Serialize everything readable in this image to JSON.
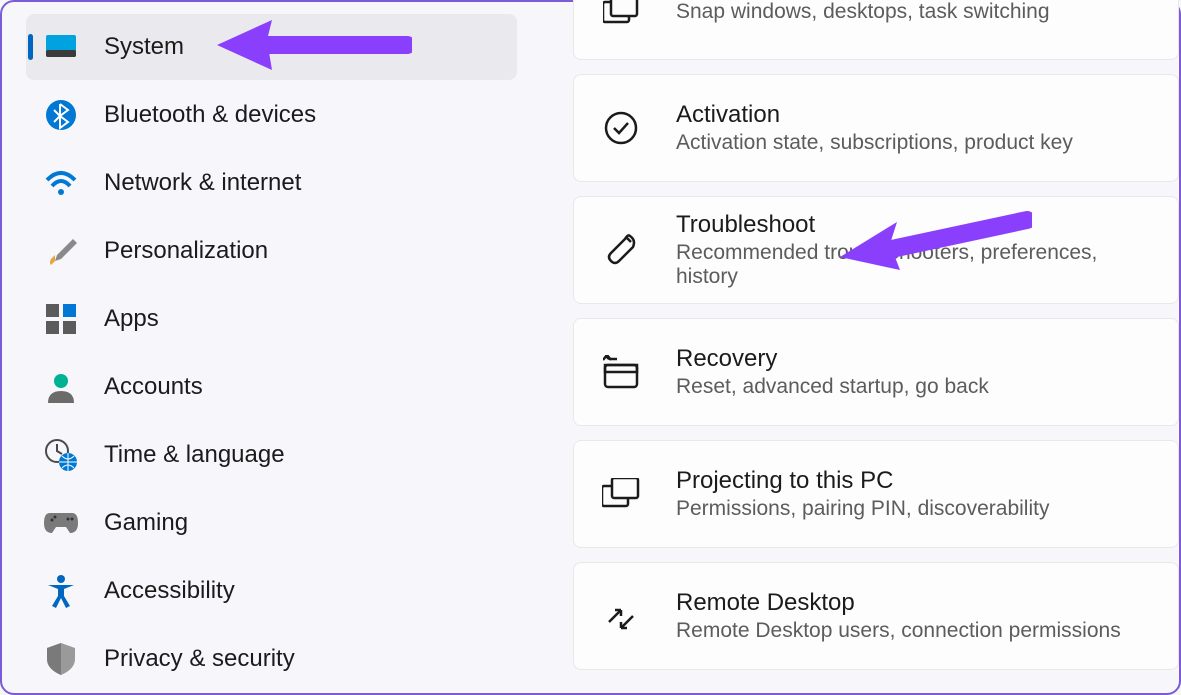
{
  "sidebar": {
    "items": [
      {
        "label": "System",
        "selected": true,
        "icon": "monitor-icon"
      },
      {
        "label": "Bluetooth & devices",
        "selected": false,
        "icon": "bluetooth-icon"
      },
      {
        "label": "Network & internet",
        "selected": false,
        "icon": "wifi-icon"
      },
      {
        "label": "Personalization",
        "selected": false,
        "icon": "brush-icon"
      },
      {
        "label": "Apps",
        "selected": false,
        "icon": "apps-icon"
      },
      {
        "label": "Accounts",
        "selected": false,
        "icon": "person-icon"
      },
      {
        "label": "Time & language",
        "selected": false,
        "icon": "clock-globe-icon"
      },
      {
        "label": "Gaming",
        "selected": false,
        "icon": "gamepad-icon"
      },
      {
        "label": "Accessibility",
        "selected": false,
        "icon": "accessibility-icon"
      },
      {
        "label": "Privacy & security",
        "selected": false,
        "icon": "shield-icon"
      }
    ]
  },
  "content": {
    "cards": [
      {
        "title": "",
        "sub": "Snap windows, desktops, task switching",
        "icon": "multitask-icon"
      },
      {
        "title": "Activation",
        "sub": "Activation state, subscriptions, product key",
        "icon": "checkmark-circle-icon"
      },
      {
        "title": "Troubleshoot",
        "sub": "Recommended troubleshooters, preferences, history",
        "icon": "wrench-icon"
      },
      {
        "title": "Recovery",
        "sub": "Reset, advanced startup, go back",
        "icon": "recovery-icon"
      },
      {
        "title": "Projecting to this PC",
        "sub": "Permissions, pairing PIN, discoverability",
        "icon": "project-icon"
      },
      {
        "title": "Remote Desktop",
        "sub": "Remote Desktop users, connection permissions",
        "icon": "remote-desktop-icon"
      }
    ]
  },
  "annotations": {
    "arrow1_target": "System",
    "arrow2_target": "Troubleshoot",
    "arrow_color": "#8a3ffc"
  }
}
